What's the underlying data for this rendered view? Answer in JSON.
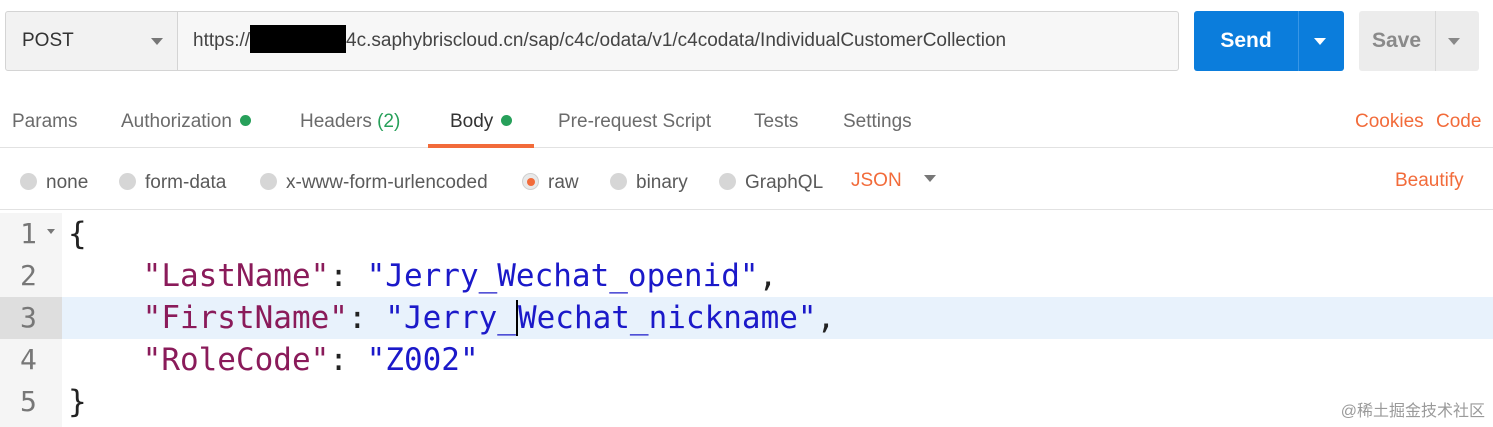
{
  "request": {
    "method": "POST",
    "url_prefix": "https://",
    "url_suffix": "4c.saphybriscloud.cn/sap/c4c/odata/v1/c4codata/IndividualCustomerCollection",
    "send_label": "Send",
    "save_label": "Save"
  },
  "tabs": [
    {
      "label": "Params"
    },
    {
      "label": "Authorization"
    },
    {
      "label": "Headers",
      "count": "(2)"
    },
    {
      "label": "Body"
    },
    {
      "label": "Pre-request Script"
    },
    {
      "label": "Tests"
    },
    {
      "label": "Settings"
    }
  ],
  "tab_links": {
    "cookies": "Cookies",
    "code": "Code"
  },
  "body_types": [
    "none",
    "form-data",
    "x-www-form-urlencoded",
    "raw",
    "binary",
    "GraphQL"
  ],
  "selected_body_type": "raw",
  "format_select": "JSON",
  "beautify_label": "Beautify",
  "editor": {
    "line_numbers": [
      "1",
      "2",
      "3",
      "4",
      "5"
    ],
    "highlighted_line": 3,
    "lines": {
      "l1": "{",
      "l2_key": "\"LastName\"",
      "l2_colon": ": ",
      "l2_val": "\"Jerry_Wechat_openid\"",
      "l2_end": ",",
      "l3_key": "\"FirstName\"",
      "l3_colon": ": ",
      "l3_val_a": "\"Jerry_",
      "l3_val_b": "Wechat_nickname\"",
      "l3_end": ",",
      "l4_key": "\"RoleCode\"",
      "l4_colon": ": ",
      "l4_val": "\"Z002\"",
      "l5": "}"
    }
  },
  "watermark": "@稀土掘金技术社区",
  "colors": {
    "accent": "#f26b3a",
    "send": "#0b7ddc",
    "dot": "#27a05a",
    "json_key": "#8a1b5a",
    "json_string": "#1b19c9",
    "highlight": "#e8f2fc"
  }
}
